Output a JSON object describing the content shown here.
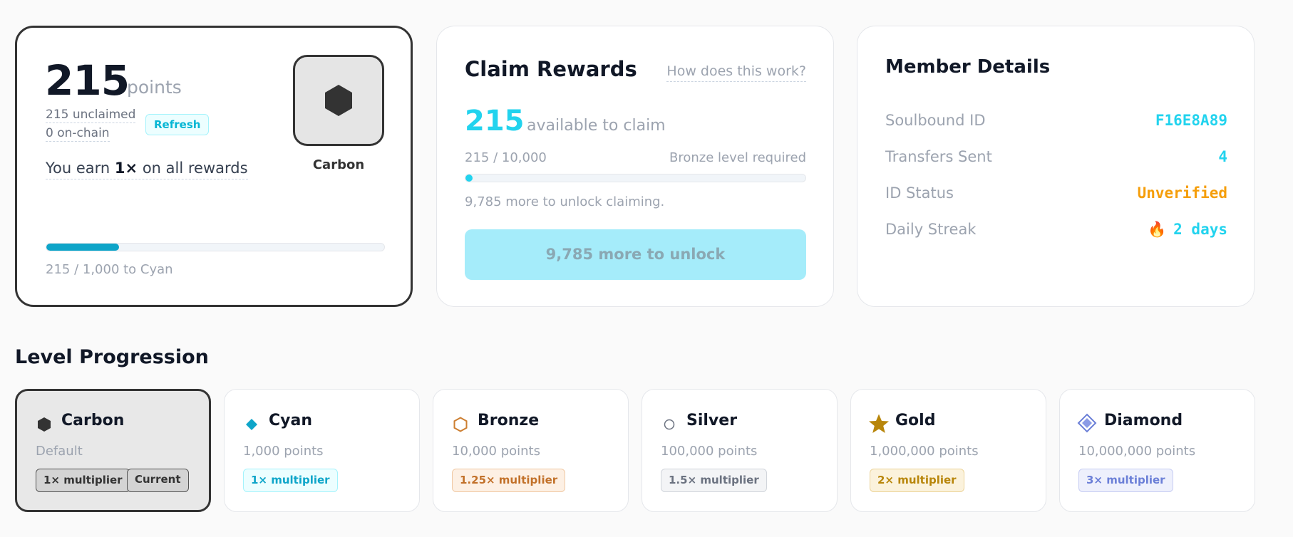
{
  "points_card": {
    "points": "215",
    "points_unit": "points",
    "unclaimed": "215 unclaimed",
    "onchain": "0 on-chain",
    "refresh_label": "Refresh",
    "earn_prefix": "You earn ",
    "earn_multiplier": "1×",
    "earn_suffix": " on all rewards",
    "level_name": "Carbon",
    "progress_fraction": 0.215,
    "progress_caption": "215 / 1,000 to Cyan"
  },
  "claim_card": {
    "title": "Claim Rewards",
    "help_link": "How does this work?",
    "amount": "215",
    "amount_caption": "available to claim",
    "ratio": "215 / 10,000",
    "requirement": "Bronze level required",
    "progress_fraction": 0.0215,
    "more_text": "9,785 more to unlock claiming.",
    "button_label": "9,785 more to unlock"
  },
  "member_card": {
    "title": "Member Details",
    "rows": [
      {
        "label": "Soulbound ID",
        "value": "F16E8A89",
        "color": "#22d3ee"
      },
      {
        "label": "Transfers Sent",
        "value": "4",
        "color": "#22d3ee"
      },
      {
        "label": "ID Status",
        "value": "Unverified",
        "color": "#f59e0b"
      },
      {
        "label": "Daily Streak",
        "value": "2 days",
        "icon": "fire-icon",
        "color": "#22d3ee"
      }
    ]
  },
  "level_progression": {
    "title": "Level Progression",
    "current_label": "Current",
    "levels": [
      {
        "name": "Carbon",
        "points": "Default",
        "multiplier": "1× multiplier",
        "icon": "hexagon-filled-icon",
        "color": "#333333",
        "current": true
      },
      {
        "name": "Cyan",
        "points": "1,000 points",
        "multiplier": "1× multiplier",
        "icon": "diamond-icon",
        "color": "#0ea5c9"
      },
      {
        "name": "Bronze",
        "points": "10,000 points",
        "multiplier": "1.25× multiplier",
        "icon": "hexagon-outline-icon",
        "color": "#cd7f32"
      },
      {
        "name": "Silver",
        "points": "100,000 points",
        "multiplier": "1.5× multiplier",
        "icon": "circle-outline-icon",
        "color": "#9ca3af"
      },
      {
        "name": "Gold",
        "points": "1,000,000 points",
        "multiplier": "2× multiplier",
        "icon": "star-icon",
        "color": "#b8860b"
      },
      {
        "name": "Diamond",
        "points": "10,000,000 points",
        "multiplier": "3× multiplier",
        "icon": "gem-icon",
        "color": "#6b7fd7"
      }
    ]
  }
}
